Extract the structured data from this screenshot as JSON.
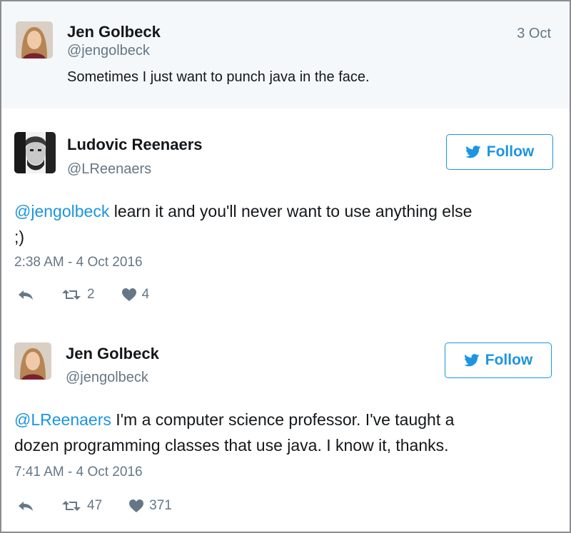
{
  "tweets": [
    {
      "name": "Jen Golbeck",
      "handle": "@jengolbeck",
      "date": "3 Oct",
      "text": "Sometimes I just want to punch java in the face."
    },
    {
      "name": "Ludovic Reenaers",
      "handle": "@LReenaers",
      "follow_label": "Follow",
      "mention": "@jengolbeck",
      "text_line1": " learn it and you'll never want to use anything else",
      "text_line2": ";)",
      "timestamp": "2:38 AM - 4 Oct 2016",
      "retweets": "2",
      "likes": "4"
    },
    {
      "name": "Jen Golbeck",
      "handle": "@jengolbeck",
      "follow_label": "Follow",
      "mention": "@LReenaers",
      "text_line1": " I'm a computer science professor. I've taught a",
      "text_line2": "dozen programming classes that use java. I know it, thanks.",
      "timestamp": "7:41 AM - 4 Oct 2016",
      "retweets": "47",
      "likes": "371"
    }
  ],
  "colors": {
    "accent": "#1b95e0",
    "muted": "#657786",
    "text": "#14171a",
    "top_bg": "#f5f8fa"
  },
  "icons": [
    "reply-icon",
    "retweet-icon",
    "heart-icon",
    "twitter-bird-icon"
  ]
}
